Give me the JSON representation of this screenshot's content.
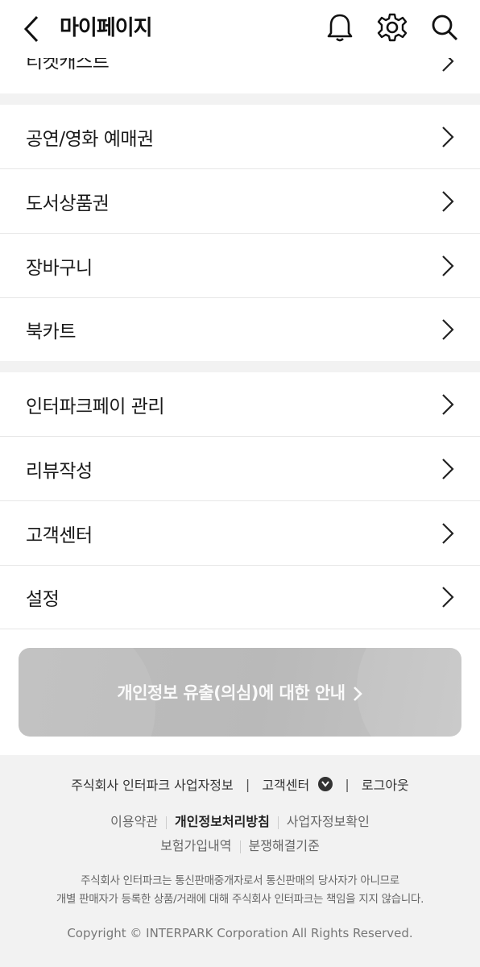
{
  "header": {
    "title": "마이페이지"
  },
  "menu": {
    "partial_item": "티켓캐스트",
    "group1": [
      "공연/영화 예매권",
      "도서상품권",
      "장바구니",
      "북카트"
    ],
    "group2": [
      "인터파크페이 관리",
      "리뷰작성",
      "고객센터",
      "설정"
    ]
  },
  "banner": {
    "text": "개인정보 유출(의심)에 대한 안내"
  },
  "footer": {
    "company_info": "주식회사 인터파크 사업자정보",
    "separator": "|",
    "customer_center": "고객센터",
    "logout": "로그아웃",
    "terms": "이용약관",
    "privacy": "개인정보처리방침",
    "business_check": "사업자정보확인",
    "insurance": "보험가입내역",
    "dispute": "분쟁해결기준",
    "notice_line1": "주식회사 인터파크는 통신판매중개자로서 통신판매의 당사자가 아니므로",
    "notice_line2": "개별 판매자가 등록한 상품/거래에 대해 주식회사 인터파크는 책임을 지지 않습니다.",
    "copyright": "Copyright © INTERPARK Corporation All Rights Reserved."
  }
}
